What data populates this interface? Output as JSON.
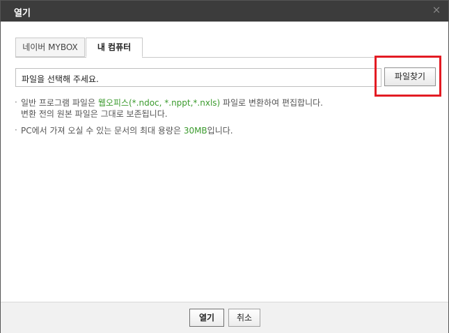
{
  "dialog": {
    "title": "열기",
    "close_glyph": "×"
  },
  "tabs": [
    {
      "label": "네이버 MYBOX",
      "active": false
    },
    {
      "label": "내 컴퓨터",
      "active": true
    }
  ],
  "file": {
    "placeholder_text": "파일을 선택해 주세요.",
    "browse_label": "파일찾기"
  },
  "notes": {
    "n1_pre": "일반 프로그램 파일은 ",
    "n1_green": "웹오피스(*.ndoc, *.nppt,*.nxls)",
    "n1_post": " 파일로 변환하여 편집합니다.",
    "n1_line2": "변환 전의 원본 파일은 그대로 보존됩니다.",
    "n2_pre": "PC에서 가져 오실 수 있는 문서의 최대 용량은 ",
    "n2_green": "30MB",
    "n2_post": "입니다.",
    "bullet": "·"
  },
  "footer": {
    "ok_label": "열기",
    "cancel_label": "취소"
  },
  "colors": {
    "titlebar": "#3c3c3c",
    "highlight": "#e31b23",
    "accent_green": "#3a9a2c"
  }
}
